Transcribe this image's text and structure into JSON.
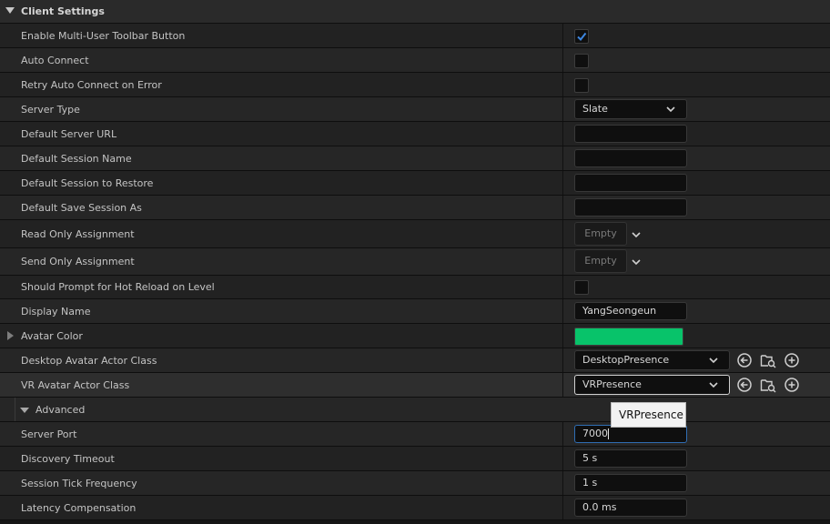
{
  "section": {
    "title": "Client Settings"
  },
  "rows": {
    "toolbar_button": {
      "label": "Enable Multi-User Toolbar Button",
      "checked": true
    },
    "auto_connect": {
      "label": "Auto Connect",
      "checked": false
    },
    "retry_auto_connect": {
      "label": "Retry Auto Connect on Error",
      "checked": false
    },
    "server_type": {
      "label": "Server Type",
      "value": "Slate"
    },
    "default_server_url": {
      "label": "Default Server URL",
      "value": ""
    },
    "default_session_name": {
      "label": "Default Session Name",
      "value": ""
    },
    "default_session_restore": {
      "label": "Default Session to Restore",
      "value": ""
    },
    "default_save_session": {
      "label": "Default Save Session As",
      "value": ""
    },
    "read_only_assignment": {
      "label": "Read Only Assignment",
      "value": "Empty"
    },
    "send_only_assignment": {
      "label": "Send Only Assignment",
      "value": "Empty"
    },
    "hot_reload_prompt": {
      "label": "Should Prompt for Hot Reload on Level",
      "checked": false
    },
    "display_name": {
      "label": "Display Name",
      "value": "YangSeongeun"
    },
    "avatar_color": {
      "label": "Avatar Color",
      "color": "#08c36a"
    },
    "desktop_avatar": {
      "label": "Desktop Avatar Actor Class",
      "value": "DesktopPresence"
    },
    "vr_avatar": {
      "label": "VR Avatar Actor Class",
      "value": "VRPresence"
    },
    "advanced": {
      "label": "Advanced"
    },
    "server_port": {
      "label": "Server Port",
      "value": "7000"
    },
    "discovery_timeout": {
      "label": "Discovery Timeout",
      "value": "5 s"
    },
    "session_tick": {
      "label": "Session Tick Frequency",
      "value": "1 s"
    },
    "latency_comp": {
      "label": "Latency Compensation",
      "value": "0.0 ms"
    }
  },
  "tooltip": {
    "text": "VRPresence"
  },
  "icons": [
    "collapse-triangle-icon",
    "checkmark-icon",
    "chevron-down-icon",
    "expand-arrow-icon",
    "use-selected-icon",
    "browse-asset-icon",
    "add-new-icon"
  ],
  "colors": {
    "accent": "#2f6db3",
    "avatar": "#08c36a"
  }
}
